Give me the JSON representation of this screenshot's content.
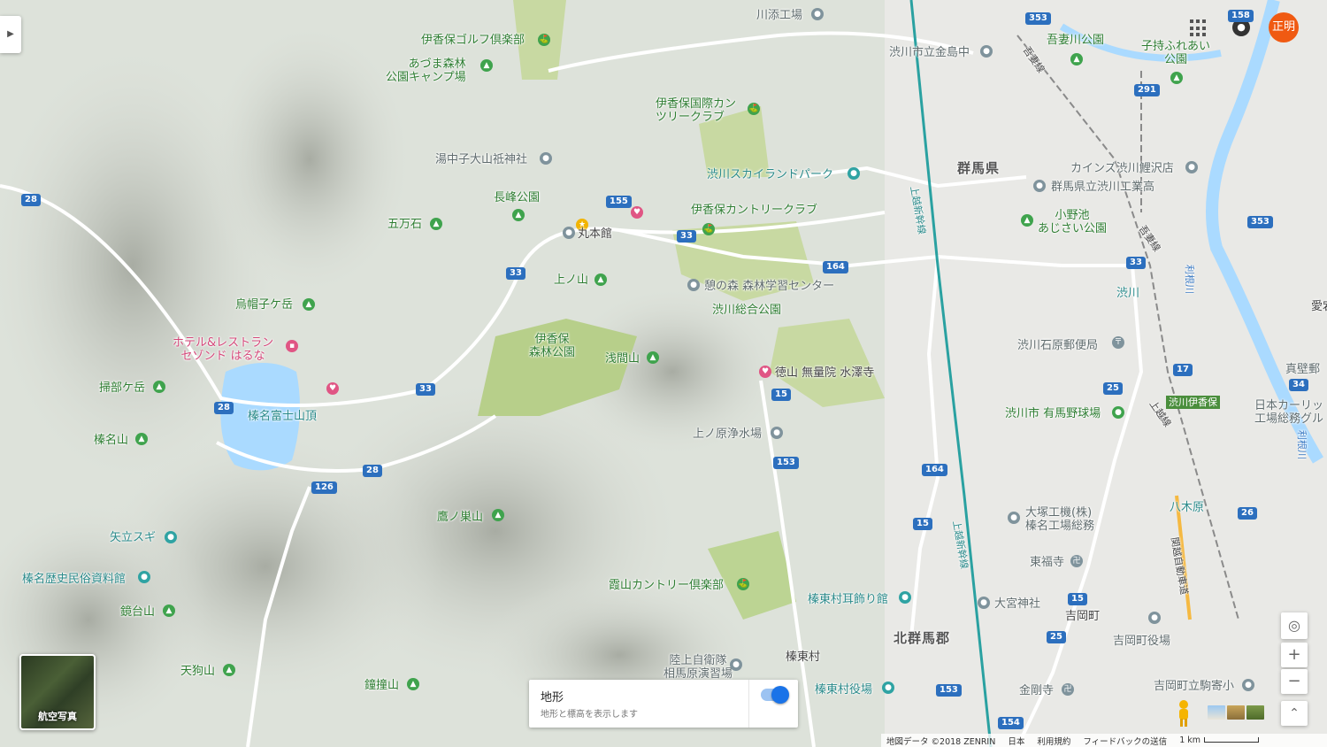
{
  "header": {
    "avatar_text": "正明",
    "apps_icon": "apps-grid-icon",
    "notification_icon": "bell-icon"
  },
  "labels": {
    "ikaho_golf": "伊香保ゴルフ倶楽部",
    "azuma_forest": "あづま森林\n公園キャンプ場",
    "kawazoe": "川添工場",
    "shibukawa_chu": "渋川市立金島中",
    "agatsuma_park": "吾妻川公園",
    "kodomo_park": "子持ふれあい\n公園",
    "ikaho_intl": "伊香保国際カン\nツリークラブ",
    "yunaka": "湯中子大山祗神社",
    "sky_land": "渋川スカイランドパーク",
    "gunma_pref": "群馬県",
    "cainz": "カインズ渋川鯉沢店",
    "gunma_tech": "群馬県立渋川工業高",
    "nagamine_park": "長峰公園",
    "gomanseki": "五万石",
    "maruhonkan": "丸本館",
    "ikaho_country": "伊香保カントリークラブ",
    "onoike": "小野池\nあじさい公園",
    "uenoyama": "上ノ山",
    "ikoi_forest": "憩の森 森林学習センター",
    "shibukawa_park": "渋川総合公園",
    "shibukawa_station": "渋川",
    "eboshi": "烏帽子ケ岳",
    "hotel": "ホテル&レストラン\nセゾンド はるな",
    "ikaho_forest_park": "伊香保\n森林公園",
    "asama": "浅間山",
    "shibukawa_post": "渋川石原郵便局",
    "tokuyama": "徳山 無量院 水澤寺",
    "kakobegatake": "掃部ケ岳",
    "haruna_fuji": "榛名富士山頂",
    "shibukawa_baseball": "渋川市 有馬野球場",
    "shibukawa_ikaho_ic": "渋川伊香保",
    "nihon_carlit": "日本カーリッ\n工場総務グル",
    "kamishima": "真壁郵",
    "haruna_san": "榛名山",
    "uenohara": "上ノ原浄水場",
    "takanosu": "鷹ノ巣山",
    "otsuka": "大塚工機(株)\n榛名工場総務",
    "yagihara": "八木原",
    "yadate_sugi": "矢立スギ",
    "haruna_museum": "榛名歴史民俗資料館",
    "tofukuji": "東福寺",
    "kasumiyama": "霞山カントリー倶楽部",
    "shinto_mimikazari": "榛東村耳飾り館",
    "omiya": "大宮神社",
    "yoshioka": "吉岡町",
    "kagamidai": "鏡台山",
    "kitagunma": "北群馬郡",
    "yoshioka_office": "吉岡町役場",
    "jieitai": "陸上自衛隊\n相馬原演習場",
    "shinto": "榛東村",
    "tengu": "天狗山",
    "shoto": "鐘撞山",
    "shinto_office": "榛東村役場",
    "kongoji": "金剛寺",
    "yoshioka_koma": "吉岡町立駒寄小",
    "joetsu_line": "上越線",
    "agatsuma_line": "吾妻線",
    "joetsu_shinkansen": "上越新幹線",
    "kanetsu": "関越自動車道",
    "aigi": "愛宕",
    "tonegawa": "利根川",
    "shinsyo": "子持"
  },
  "roads": [
    "28",
    "126",
    "33",
    "155",
    "164",
    "15",
    "153",
    "17",
    "25",
    "26",
    "34",
    "353",
    "291",
    "158",
    "154"
  ],
  "terrain_card": {
    "title": "地形",
    "subtitle": "地形と標高を表示します",
    "enabled": true
  },
  "aerial_label": "航空写真",
  "controls": {
    "my_location": "◎",
    "zoom_in": "+",
    "zoom_out": "−",
    "expand": "⌃"
  },
  "footer": {
    "attribution": "地図データ ©2018 ZENRIN",
    "country": "日本",
    "terms": "利用規約",
    "feedback": "フィードバックの送信",
    "scale": "1 km"
  }
}
